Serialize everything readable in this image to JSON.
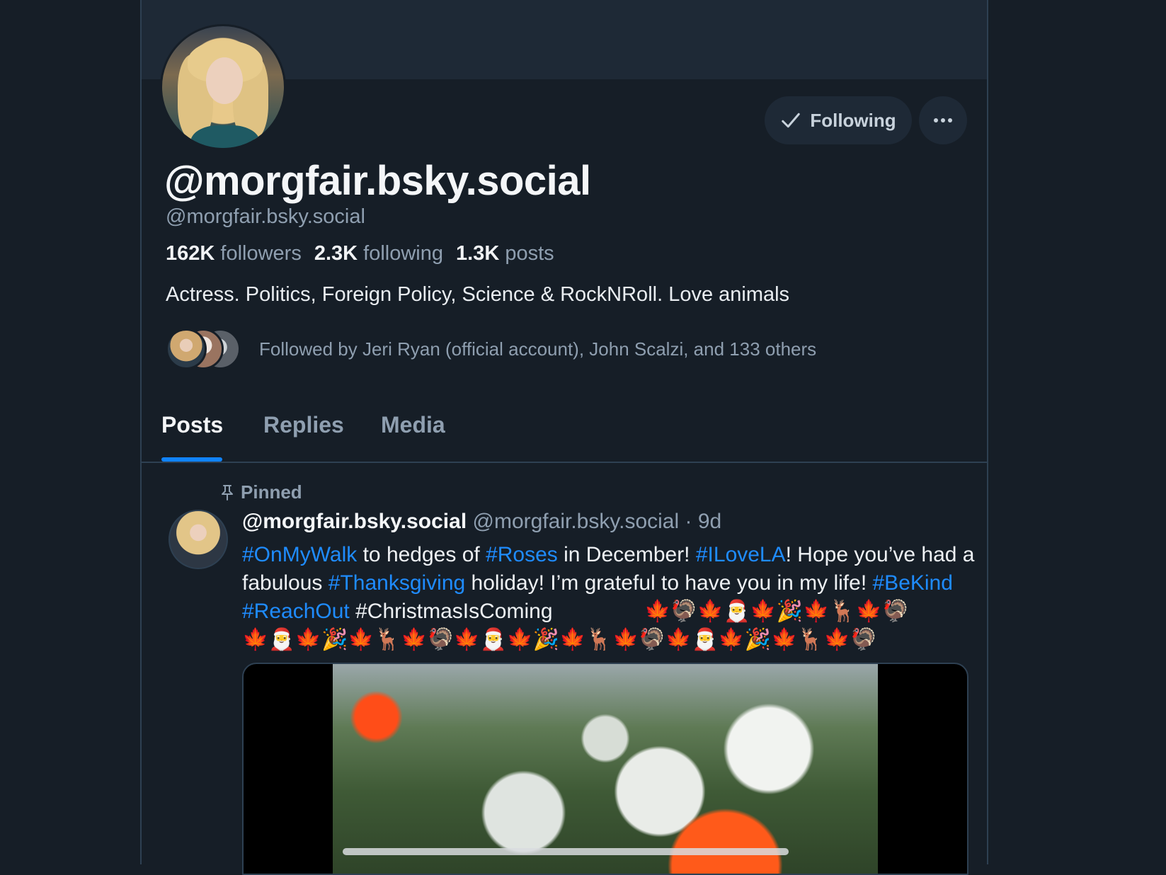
{
  "profile": {
    "display_name": "@morgfair.bsky.social",
    "handle": "@morgfair.bsky.social",
    "followers_count": "162K",
    "followers_label": "followers",
    "following_count": "2.3K",
    "following_label": "following",
    "posts_count": "1.3K",
    "posts_label": "posts",
    "bio": "Actress. Politics, Foreign Policy, Science & RockNRoll. Love animals",
    "followed_by": "Followed by Jeri Ryan (official account), John Scalzi, and 133 others"
  },
  "actions": {
    "following_label": "Following"
  },
  "tabs": [
    {
      "label": "Posts",
      "active": true
    },
    {
      "label": "Replies",
      "active": false
    },
    {
      "label": "Media",
      "active": false
    }
  ],
  "post": {
    "pinned_label": "Pinned",
    "author_name": "@morgfair.bsky.social",
    "author_handle": "@morgfair.bsky.social",
    "age": "9d",
    "text_parts": [
      {
        "text": "#OnMyWalk",
        "tag": true
      },
      {
        "text": " to hedges of ",
        "tag": false
      },
      {
        "text": "#Roses",
        "tag": true
      },
      {
        "text": " in December! ",
        "tag": false
      },
      {
        "text": "#ILoveLA",
        "tag": true
      },
      {
        "text": "! Hope you’ve had a fabulous ",
        "tag": false
      },
      {
        "text": "#Thanksgiving",
        "tag": true
      },
      {
        "text": " holiday! I’m grateful to have you in my life! ",
        "tag": false
      },
      {
        "text": "#BeKind",
        "tag": true
      },
      {
        "text": " ",
        "tag": false
      },
      {
        "text": "#ReachOut",
        "tag": true
      },
      {
        "text": " #ChristmasIsComing",
        "tag": false
      }
    ],
    "emoji_line_1": "🍁🦃🍁🎅🍁🎉🍁🦌🍁🦃",
    "emoji_line_2": "🍁🎅🍁🎉🍁🦌🍁🦃🍁🎅🍁🎉🍁🦌🍁🦃🍁🎅🍁🎉🍁🦌🍁🦃"
  },
  "icons": {
    "check": "check-icon",
    "more": "more-icon",
    "pin": "pin-icon"
  },
  "colors": {
    "background": "#161e27",
    "banner": "#1e2936",
    "accent": "#1083fe",
    "hashtag": "#1f8cff",
    "muted_text": "#8f9fb0"
  }
}
